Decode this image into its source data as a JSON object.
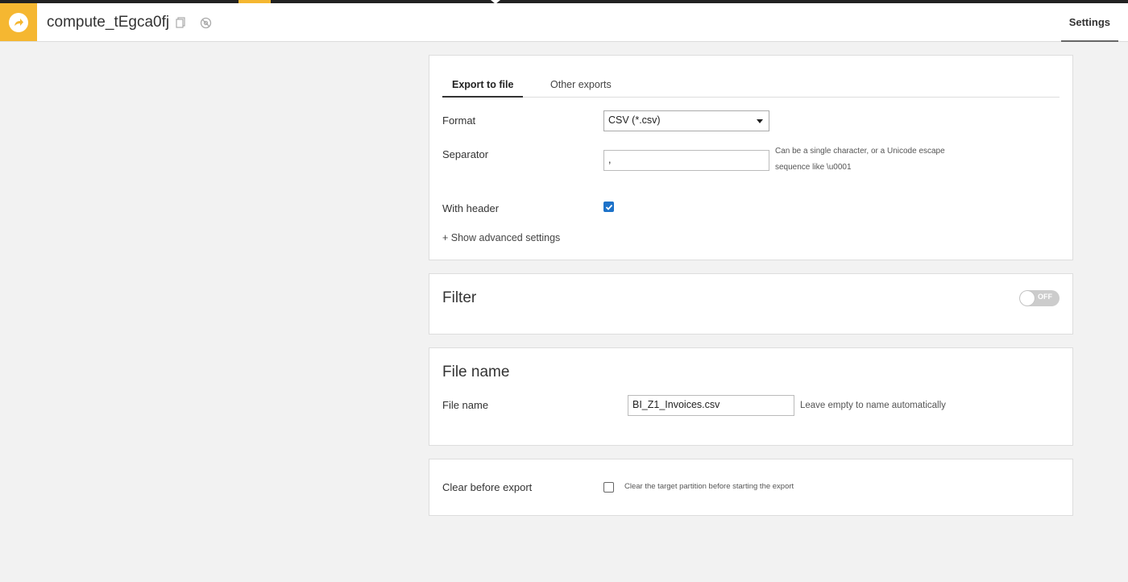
{
  "header": {
    "title": "compute_tEgca0fj",
    "logo_icon": "recipe-arrow-icon",
    "copy_icon": "copy-icon",
    "settings_icon": "gear-icon",
    "tab_settings": "Settings",
    "accent_color": "#f5b731"
  },
  "export": {
    "tabs": [
      "Export to file",
      "Other exports"
    ],
    "format_label": "Format",
    "format_value": "CSV (*.csv)",
    "separator_label": "Separator",
    "separator_value": ",",
    "separator_hint_line1": "Can be a single character, or a Unicode escape",
    "separator_hint_line2": "sequence like \\u0001",
    "with_header_label": "With header",
    "with_header_checked": true,
    "advanced_link": "+ Show advanced settings"
  },
  "filter": {
    "title": "Filter",
    "toggle_label": "OFF"
  },
  "file_name": {
    "title": "File name",
    "label": "File name",
    "value": "BI_Z1_Invoices.csv",
    "hint": "Leave empty to name automatically"
  },
  "clear": {
    "label": "Clear before export",
    "checked": false,
    "hint": "Clear the target partition before starting the export"
  }
}
